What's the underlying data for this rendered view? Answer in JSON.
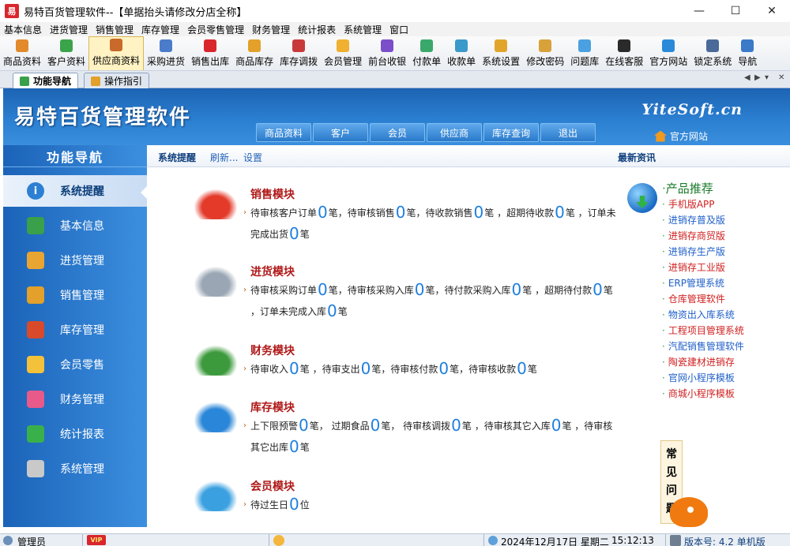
{
  "window": {
    "title": "易特百货管理软件--【单据抬头请修改分店全称】",
    "icon_text": "易",
    "controls": [
      "—",
      "☐",
      "✕"
    ]
  },
  "menubar": [
    "基本信息",
    "进货管理",
    "销售管理",
    "库存管理",
    "会员零售管理",
    "财务管理",
    "统计报表",
    "系统管理",
    "窗口"
  ],
  "toolbar": [
    {
      "label": "商品资料",
      "icon": "product-icon",
      "color": "#e28a2c"
    },
    {
      "label": "客户资料",
      "icon": "customer-icon",
      "color": "#3ba34a"
    },
    {
      "label": "供应商资料",
      "icon": "supplier-icon",
      "color": "#c96a2a",
      "active": true
    },
    {
      "label": "采购进货",
      "icon": "purchase-icon",
      "color": "#4a7cc9"
    },
    {
      "label": "销售出库",
      "icon": "sales-outbound-icon",
      "color": "#d9262c"
    },
    {
      "label": "商品库存",
      "icon": "stock-icon",
      "color": "#e3a02a"
    },
    {
      "label": "库存调拨",
      "icon": "transfer-icon",
      "color": "#c83a3a"
    },
    {
      "label": "会员管理",
      "icon": "member-icon",
      "color": "#f0b030"
    },
    {
      "label": "前台收银",
      "icon": "cashier-icon",
      "color": "#7a4fc9"
    },
    {
      "label": "付款单",
      "icon": "payment-icon",
      "color": "#3aa86a"
    },
    {
      "label": "收款单",
      "icon": "receipt-icon",
      "color": "#3a9ac9"
    },
    {
      "label": "系统设置",
      "icon": "settings-icon",
      "color": "#e2a52c"
    },
    {
      "label": "修改密码",
      "icon": "password-icon",
      "color": "#d8a13a"
    },
    {
      "label": "问题库",
      "icon": "question-icon",
      "color": "#4aa0e0"
    },
    {
      "label": "在线客服",
      "icon": "chat-icon",
      "color": "#2a2a2a"
    },
    {
      "label": "官方网站",
      "icon": "website-icon",
      "color": "#2a8ad9"
    },
    {
      "label": "锁定系统",
      "icon": "lock-icon",
      "color": "#4a6a9a"
    },
    {
      "label": "导航",
      "icon": "navigation-icon",
      "color": "#3a7ac9"
    }
  ],
  "tabs": [
    {
      "label": "功能导航",
      "active": true
    },
    {
      "label": "操作指引",
      "active": false
    }
  ],
  "tab_controls": [
    "◀",
    "▶",
    "▾",
    "✕"
  ],
  "banner": {
    "title": "易特百货管理软件",
    "brand": "YiteSoft.cn",
    "nav": [
      "商品资料",
      "客户",
      "会员",
      "供应商",
      "库存查询",
      "退出"
    ],
    "official_link": "官方网站"
  },
  "sidebar": {
    "title": "功能导航",
    "items": [
      {
        "label": "系统提醒",
        "icon": "info-icon",
        "color": "#2d7fd3",
        "active": true
      },
      {
        "label": "基本信息",
        "icon": "basic-info-icon",
        "color": "#3aa04a"
      },
      {
        "label": "进货管理",
        "icon": "purchase-mgmt-icon",
        "color": "#e8a532"
      },
      {
        "label": "销售管理",
        "icon": "sales-mgmt-icon",
        "color": "#e3a02a"
      },
      {
        "label": "库存管理",
        "icon": "inventory-mgmt-icon",
        "color": "#d84a2a"
      },
      {
        "label": "会员零售",
        "icon": "member-retail-icon",
        "color": "#f3c23a"
      },
      {
        "label": "财务管理",
        "icon": "finance-mgmt-icon",
        "color": "#e85a8a"
      },
      {
        "label": "统计报表",
        "icon": "report-icon",
        "color": "#3ab04a"
      },
      {
        "label": "系统管理",
        "icon": "system-mgmt-icon",
        "color": "#c9c9c9"
      }
    ]
  },
  "content_bar": {
    "title": "系统提醒",
    "refresh": "刷新...",
    "settings": "设置",
    "news": "最新资讯"
  },
  "modules": [
    {
      "title": "销售模块",
      "icon": "sale-car-icon",
      "parts": [
        {
          "t": "待审核客户订单"
        },
        {
          "n": "0"
        },
        {
          "t": "笔，待审核销售"
        },
        {
          "n": "0"
        },
        {
          "t": "笔，待收款销售"
        },
        {
          "n": "0"
        },
        {
          "t": "笔 ，超期待收款"
        },
        {
          "n": "0"
        },
        {
          "t": "笔 ，订单未完成出货"
        },
        {
          "n": "0"
        },
        {
          "t": "笔"
        }
      ]
    },
    {
      "title": "进货模块",
      "icon": "cart-icon",
      "parts": [
        {
          "t": "待审核采购订单"
        },
        {
          "n": "0"
        },
        {
          "t": "笔，待审核采购入库"
        },
        {
          "n": "0"
        },
        {
          "t": "笔，待付款采购入库"
        },
        {
          "n": "0"
        },
        {
          "t": "笔 ，超期待付款"
        },
        {
          "n": "0"
        },
        {
          "t": "笔 ，订单未完成入库"
        },
        {
          "n": "0"
        },
        {
          "t": "笔"
        }
      ]
    },
    {
      "title": "财务模块",
      "icon": "finance-chart-icon",
      "parts": [
        {
          "t": "待审收入"
        },
        {
          "n": "0"
        },
        {
          "t": "笔 ，待审支出"
        },
        {
          "n": "0"
        },
        {
          "t": "笔，待审核付款"
        },
        {
          "n": "0"
        },
        {
          "t": "笔，待审核收款"
        },
        {
          "n": "0"
        },
        {
          "t": "笔"
        }
      ]
    },
    {
      "title": "库存模块",
      "icon": "boxes-icon",
      "parts": [
        {
          "t": "上下限预警"
        },
        {
          "n": "0"
        },
        {
          "t": "笔， 过期食品"
        },
        {
          "n": "0"
        },
        {
          "t": "笔， 待审核调拨"
        },
        {
          "n": "0"
        },
        {
          "t": "笔 ，待审核其它入库"
        },
        {
          "n": "0"
        },
        {
          "t": "笔 ，待审核其它出库"
        },
        {
          "n": "0"
        },
        {
          "t": "笔"
        }
      ]
    },
    {
      "title": "会员模块",
      "icon": "chat-bubble-icon",
      "parts": [
        {
          "t": "待过生日"
        },
        {
          "n": "0"
        },
        {
          "t": "位"
        }
      ]
    }
  ],
  "recommend": {
    "title": "产品推荐",
    "items": [
      {
        "label": "手机版APP",
        "color": "#d01f1f"
      },
      {
        "label": "进销存普及版",
        "color": "#1f5fc9"
      },
      {
        "label": "进销存商贸版",
        "color": "#d01f1f"
      },
      {
        "label": "进销存生产版",
        "color": "#1f5fc9"
      },
      {
        "label": "进销存工业版",
        "color": "#d01f1f"
      },
      {
        "label": "ERP管理系统",
        "color": "#1f5fc9"
      },
      {
        "label": "仓库管理软件",
        "color": "#d01f1f"
      },
      {
        "label": "物资出入库系统",
        "color": "#1f5fc9"
      },
      {
        "label": "工程项目管理系统",
        "color": "#d01f1f"
      },
      {
        "label": "汽配销售管理软件",
        "color": "#1f5fc9"
      },
      {
        "label": "陶瓷建材进销存",
        "color": "#d01f1f"
      },
      {
        "label": "官网小程序模板",
        "color": "#1f5fc9"
      },
      {
        "label": "商城小程序模板",
        "color": "#d01f1f"
      }
    ]
  },
  "faq": [
    "常",
    "见",
    "问",
    "题"
  ],
  "statusbar": {
    "user": "管理员",
    "vip": "VIP",
    "date": "2024年12月17日 星期二",
    "time": "15:12:13",
    "version": "版本号: 4.2 单机版"
  }
}
